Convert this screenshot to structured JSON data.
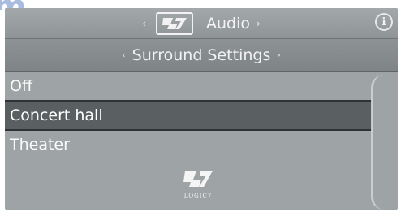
{
  "watermark": {
    "text": "com"
  },
  "header": {
    "left_arrow": "‹",
    "title": "Audio",
    "right_arrow": "›",
    "logo_icon": "logic7-icon",
    "info_icon": "i"
  },
  "subheader": {
    "left_arrow": "‹",
    "title": "Surround Settings",
    "right_arrow": "›"
  },
  "list": {
    "items": [
      {
        "label": "Off",
        "selected": false
      },
      {
        "label": "Concert hall",
        "selected": true
      },
      {
        "label": "Theater",
        "selected": false
      }
    ]
  },
  "brand": {
    "text": "LOGIC7"
  },
  "colors": {
    "screen_bg": "#9ea3a5",
    "selected_bg": "#5a5f61",
    "text": "#fafafa"
  }
}
